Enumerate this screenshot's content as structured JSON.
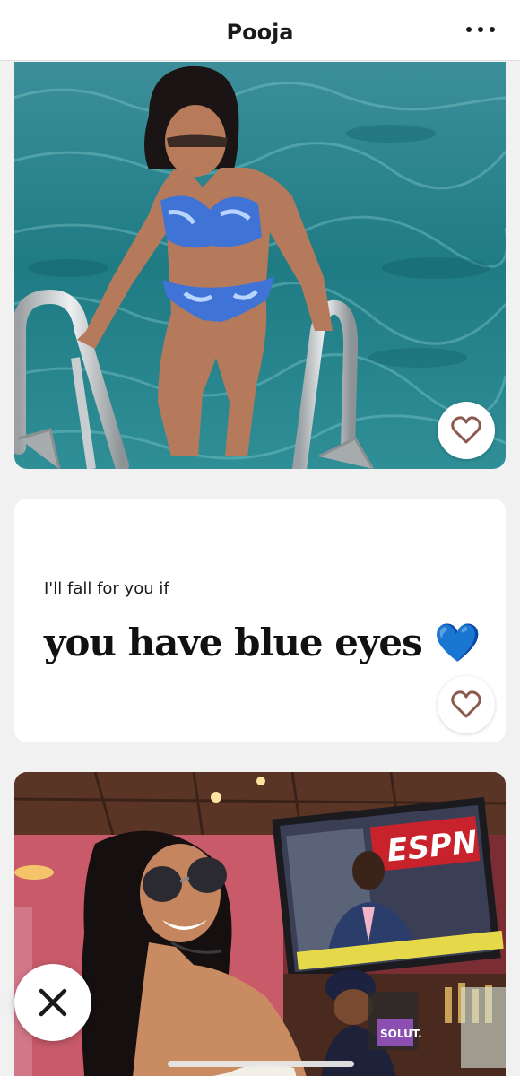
{
  "header": {
    "title": "Pooja",
    "more_icon": "more-horizontal-icon"
  },
  "photos": [
    {
      "description_icon": "photo-woman-pool-ladder"
    },
    {
      "description_icon": "photo-woman-bar-sunglasses",
      "tv_text": "ESPN",
      "sign_text": "SOLUT."
    }
  ],
  "prompt": {
    "question": "I'll fall for you if",
    "answer": "you have blue eyes 💙"
  },
  "actions": {
    "like_icon": "heart-outline-icon",
    "skip_icon": "close-x-icon"
  },
  "colors": {
    "accent_heart": "#8a5a4e",
    "background": "#f1f1f1",
    "card": "#ffffff"
  }
}
